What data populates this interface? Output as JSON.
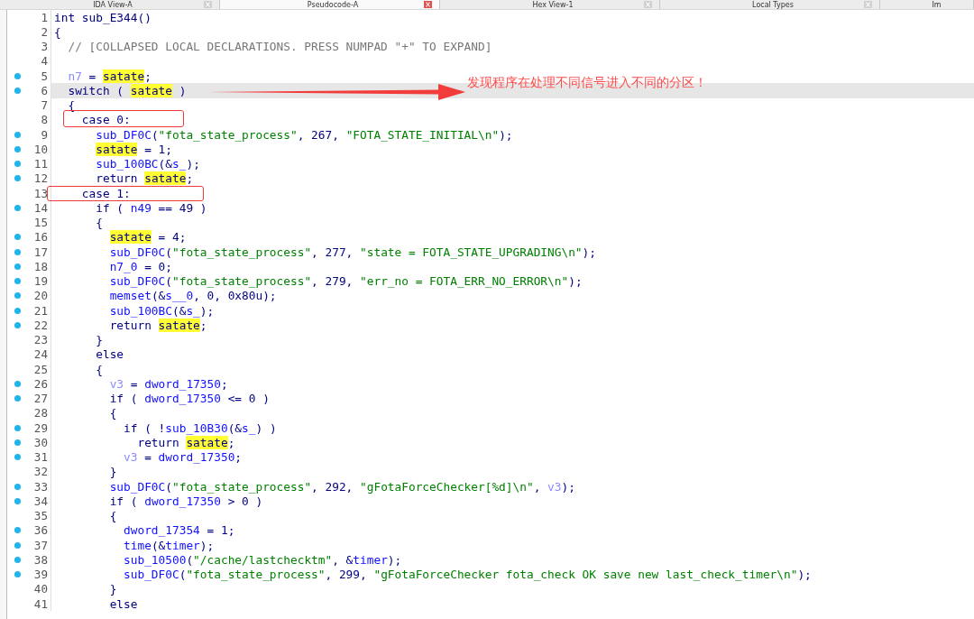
{
  "tabs": [
    {
      "label": "IDA View-A",
      "selected": false,
      "closable": true
    },
    {
      "label": "Pseudocode-A",
      "selected": true,
      "closable": true
    },
    {
      "label": "Hex View-1",
      "selected": false,
      "closable": true
    },
    {
      "label": "Local Types",
      "selected": false,
      "closable": true
    },
    {
      "label": "Im",
      "selected": false,
      "closable": false
    }
  ],
  "lines": [
    {
      "no": "1",
      "dot": false,
      "current": false,
      "tokens": [
        {
          "kind": "plain",
          "text": "int sub_E344()"
        }
      ]
    },
    {
      "no": "2",
      "dot": false,
      "current": false,
      "tokens": [
        {
          "kind": "plain",
          "text": "{"
        }
      ]
    },
    {
      "no": "3",
      "dot": false,
      "current": false,
      "tokens": [
        {
          "kind": "comment",
          "text": "  // [COLLAPSED LOCAL DECLARATIONS. PRESS NUMPAD \"+\" TO EXPAND]"
        }
      ]
    },
    {
      "no": "4",
      "dot": false,
      "current": false
    },
    {
      "no": "5",
      "dot": true,
      "current": false,
      "tokens": [
        {
          "kind": "local",
          "text": "  n7"
        },
        {
          "kind": "plain",
          "text": " = "
        },
        {
          "kind": "highlight",
          "text": "satate"
        },
        {
          "kind": "plain",
          "text": ";"
        }
      ]
    },
    {
      "no": "6",
      "dot": true,
      "current": true,
      "tokens": [
        {
          "kind": "plain",
          "text": "  switch ( "
        },
        {
          "kind": "highlight",
          "text": "satate"
        },
        {
          "kind": "plain",
          "text": " )"
        }
      ]
    },
    {
      "no": "7",
      "dot": false,
      "current": false,
      "tokens": [
        {
          "kind": "plain",
          "text": "  {"
        }
      ]
    },
    {
      "no": "8",
      "dot": false,
      "current": false,
      "tokens": [
        {
          "kind": "plain",
          "text": "    case 0:"
        }
      ]
    },
    {
      "no": "9",
      "dot": true,
      "current": false,
      "tokens": [
        {
          "kind": "name",
          "text": "      sub_DF0C"
        },
        {
          "kind": "plain",
          "text": "("
        },
        {
          "kind": "string",
          "text": "\"fota_state_process\""
        },
        {
          "kind": "plain",
          "text": ", 267, "
        },
        {
          "kind": "string",
          "text": "\"FOTA_STATE_INITIAL\\n\""
        },
        {
          "kind": "plain",
          "text": ");"
        }
      ]
    },
    {
      "no": "10",
      "dot": true,
      "current": false,
      "tokens": [
        {
          "kind": "highlight",
          "text": "      satate"
        },
        {
          "kind": "plain",
          "text": " = 1;"
        }
      ]
    },
    {
      "no": "11",
      "dot": true,
      "current": false,
      "tokens": [
        {
          "kind": "name",
          "text": "      sub_100BC"
        },
        {
          "kind": "plain",
          "text": "(&"
        },
        {
          "kind": "name",
          "text": "s_"
        },
        {
          "kind": "plain",
          "text": ");"
        }
      ]
    },
    {
      "no": "12",
      "dot": true,
      "current": false,
      "tokens": [
        {
          "kind": "plain",
          "text": "      return "
        },
        {
          "kind": "highlight",
          "text": "satate"
        },
        {
          "kind": "plain",
          "text": ";"
        }
      ]
    },
    {
      "no": "13",
      "dot": false,
      "current": false,
      "tokens": [
        {
          "kind": "plain",
          "text": "    case 1:"
        }
      ]
    },
    {
      "no": "14",
      "dot": true,
      "current": false,
      "tokens": [
        {
          "kind": "plain",
          "text": "      if ( "
        },
        {
          "kind": "name",
          "text": "n49"
        },
        {
          "kind": "plain",
          "text": " == 49 )"
        }
      ]
    },
    {
      "no": "15",
      "dot": false,
      "current": false,
      "tokens": [
        {
          "kind": "plain",
          "text": "      {"
        }
      ]
    },
    {
      "no": "16",
      "dot": true,
      "current": false,
      "tokens": [
        {
          "kind": "highlight",
          "text": "        satate"
        },
        {
          "kind": "plain",
          "text": " = 4;"
        }
      ]
    },
    {
      "no": "17",
      "dot": true,
      "current": false,
      "tokens": [
        {
          "kind": "name",
          "text": "        sub_DF0C"
        },
        {
          "kind": "plain",
          "text": "("
        },
        {
          "kind": "string",
          "text": "\"fota_state_process\""
        },
        {
          "kind": "plain",
          "text": ", 277, "
        },
        {
          "kind": "string",
          "text": "\"state = FOTA_STATE_UPGRADING\\n\""
        },
        {
          "kind": "plain",
          "text": ");"
        }
      ]
    },
    {
      "no": "18",
      "dot": true,
      "current": false,
      "tokens": [
        {
          "kind": "name",
          "text": "        n7_0"
        },
        {
          "kind": "plain",
          "text": " = 0;"
        }
      ]
    },
    {
      "no": "19",
      "dot": true,
      "current": false,
      "tokens": [
        {
          "kind": "name",
          "text": "        sub_DF0C"
        },
        {
          "kind": "plain",
          "text": "("
        },
        {
          "kind": "string",
          "text": "\"fota_state_process\""
        },
        {
          "kind": "plain",
          "text": ", 279, "
        },
        {
          "kind": "string",
          "text": "\"err_no = FOTA_ERR_NO_ERROR\\n\""
        },
        {
          "kind": "plain",
          "text": ");"
        }
      ]
    },
    {
      "no": "20",
      "dot": true,
      "current": false,
      "tokens": [
        {
          "kind": "name",
          "text": "        memset"
        },
        {
          "kind": "plain",
          "text": "(&"
        },
        {
          "kind": "name",
          "text": "s__0"
        },
        {
          "kind": "plain",
          "text": ", 0, 0x80u);"
        }
      ]
    },
    {
      "no": "21",
      "dot": true,
      "current": false,
      "tokens": [
        {
          "kind": "name",
          "text": "        sub_100BC"
        },
        {
          "kind": "plain",
          "text": "(&"
        },
        {
          "kind": "name",
          "text": "s_"
        },
        {
          "kind": "plain",
          "text": ");"
        }
      ]
    },
    {
      "no": "22",
      "dot": true,
      "current": false,
      "tokens": [
        {
          "kind": "plain",
          "text": "        return "
        },
        {
          "kind": "highlight",
          "text": "satate"
        },
        {
          "kind": "plain",
          "text": ";"
        }
      ]
    },
    {
      "no": "23",
      "dot": false,
      "current": false,
      "tokens": [
        {
          "kind": "plain",
          "text": "      }"
        }
      ]
    },
    {
      "no": "24",
      "dot": false,
      "current": false,
      "tokens": [
        {
          "kind": "plain",
          "text": "      else"
        }
      ]
    },
    {
      "no": "25",
      "dot": false,
      "current": false,
      "tokens": [
        {
          "kind": "plain",
          "text": "      {"
        }
      ]
    },
    {
      "no": "26",
      "dot": true,
      "current": false,
      "tokens": [
        {
          "kind": "local",
          "text": "        v3"
        },
        {
          "kind": "plain",
          "text": " = "
        },
        {
          "kind": "name",
          "text": "dword_17350"
        },
        {
          "kind": "plain",
          "text": ";"
        }
      ]
    },
    {
      "no": "27",
      "dot": true,
      "current": false,
      "tokens": [
        {
          "kind": "plain",
          "text": "        if ( "
        },
        {
          "kind": "name",
          "text": "dword_17350"
        },
        {
          "kind": "plain",
          "text": " <= 0 )"
        }
      ]
    },
    {
      "no": "28",
      "dot": false,
      "current": false,
      "tokens": [
        {
          "kind": "plain",
          "text": "        {"
        }
      ]
    },
    {
      "no": "29",
      "dot": true,
      "current": false,
      "tokens": [
        {
          "kind": "plain",
          "text": "          if ( !"
        },
        {
          "kind": "name",
          "text": "sub_10B30"
        },
        {
          "kind": "plain",
          "text": "(&"
        },
        {
          "kind": "name",
          "text": "s_"
        },
        {
          "kind": "plain",
          "text": ") )"
        }
      ]
    },
    {
      "no": "30",
      "dot": true,
      "current": false,
      "tokens": [
        {
          "kind": "plain",
          "text": "            return "
        },
        {
          "kind": "highlight",
          "text": "satate"
        },
        {
          "kind": "plain",
          "text": ";"
        }
      ]
    },
    {
      "no": "31",
      "dot": true,
      "current": false,
      "tokens": [
        {
          "kind": "local",
          "text": "          v3"
        },
        {
          "kind": "plain",
          "text": " = "
        },
        {
          "kind": "name",
          "text": "dword_17350"
        },
        {
          "kind": "plain",
          "text": ";"
        }
      ]
    },
    {
      "no": "32",
      "dot": false,
      "current": false,
      "tokens": [
        {
          "kind": "plain",
          "text": "        }"
        }
      ]
    },
    {
      "no": "33",
      "dot": true,
      "current": false,
      "tokens": [
        {
          "kind": "name",
          "text": "        sub_DF0C"
        },
        {
          "kind": "plain",
          "text": "("
        },
        {
          "kind": "string",
          "text": "\"fota_state_process\""
        },
        {
          "kind": "plain",
          "text": ", 292, "
        },
        {
          "kind": "string",
          "text": "\"gFotaForceChecker[%d]\\n\""
        },
        {
          "kind": "plain",
          "text": ", "
        },
        {
          "kind": "local",
          "text": "v3"
        },
        {
          "kind": "plain",
          "text": ");"
        }
      ]
    },
    {
      "no": "34",
      "dot": true,
      "current": false,
      "tokens": [
        {
          "kind": "plain",
          "text": "        if ( "
        },
        {
          "kind": "name",
          "text": "dword_17350"
        },
        {
          "kind": "plain",
          "text": " > 0 )"
        }
      ]
    },
    {
      "no": "35",
      "dot": false,
      "current": false,
      "tokens": [
        {
          "kind": "plain",
          "text": "        {"
        }
      ]
    },
    {
      "no": "36",
      "dot": true,
      "current": false,
      "tokens": [
        {
          "kind": "name",
          "text": "          dword_17354"
        },
        {
          "kind": "plain",
          "text": " = 1;"
        }
      ]
    },
    {
      "no": "37",
      "dot": true,
      "current": false,
      "tokens": [
        {
          "kind": "name",
          "text": "          time"
        },
        {
          "kind": "plain",
          "text": "(&"
        },
        {
          "kind": "name",
          "text": "timer"
        },
        {
          "kind": "plain",
          "text": ");"
        }
      ]
    },
    {
      "no": "38",
      "dot": true,
      "current": false,
      "tokens": [
        {
          "kind": "name",
          "text": "          sub_10500"
        },
        {
          "kind": "plain",
          "text": "("
        },
        {
          "kind": "string",
          "text": "\"/cache/lastchecktm\""
        },
        {
          "kind": "plain",
          "text": ", &"
        },
        {
          "kind": "name",
          "text": "timer"
        },
        {
          "kind": "plain",
          "text": ");"
        }
      ]
    },
    {
      "no": "39",
      "dot": true,
      "current": false,
      "tokens": [
        {
          "kind": "name",
          "text": "          sub_DF0C"
        },
        {
          "kind": "plain",
          "text": "("
        },
        {
          "kind": "string",
          "text": "\"fota_state_process\""
        },
        {
          "kind": "plain",
          "text": ", 299, "
        },
        {
          "kind": "string",
          "text": "\"gFotaForceChecker fota_check OK save new last_check_timer\\n\""
        },
        {
          "kind": "plain",
          "text": ");"
        }
      ]
    },
    {
      "no": "40",
      "dot": false,
      "current": false,
      "tokens": [
        {
          "kind": "plain",
          "text": "        }"
        }
      ]
    },
    {
      "no": "41",
      "dot": false,
      "current": false,
      "tokens": [
        {
          "kind": "plain",
          "text": "        else"
        }
      ]
    }
  ],
  "annotation": {
    "text": "发现程序在处理不同信号进入不同的分区！"
  }
}
